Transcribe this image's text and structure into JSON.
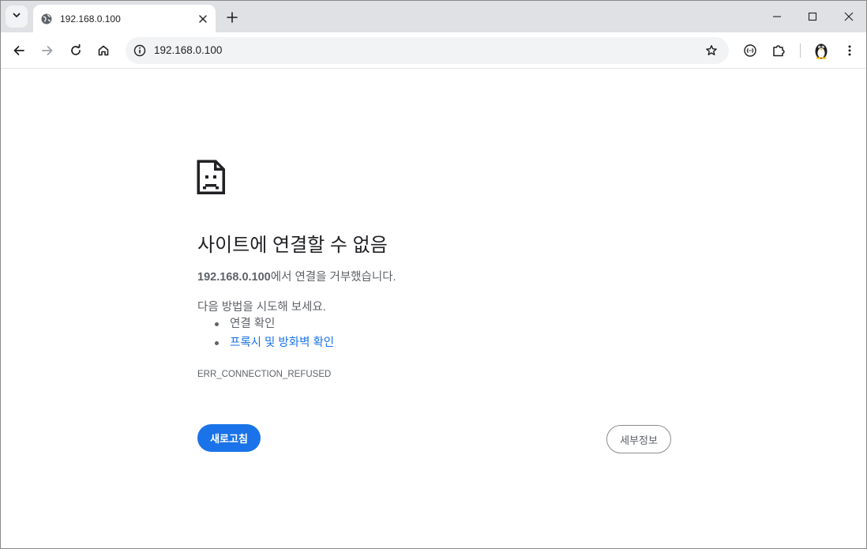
{
  "tab": {
    "title": "192.168.0.100"
  },
  "omnibox": {
    "url": "192.168.0.100"
  },
  "error": {
    "title": "사이트에 연결할 수 없음",
    "host": "192.168.0.100",
    "message_suffix": "에서 연결을 거부했습니다.",
    "suggestions_heading": "다음 방법을 시도해 보세요.",
    "suggestions": [
      {
        "label": "연결 확인"
      },
      {
        "label": "프록시 및 방화벽 확인"
      }
    ],
    "code": "ERR_CONNECTION_REFUSED",
    "reload_label": "새로고침",
    "details_label": "세부정보"
  },
  "colors": {
    "accent": "#1a73e8",
    "tabstrip": "#dfe1e5",
    "omnibox": "#f1f3f4",
    "text_secondary": "#5f6368"
  },
  "icons": [
    "chevron-down-icon",
    "globe-icon",
    "close-icon",
    "plus-icon",
    "minimize-icon",
    "maximize-icon",
    "window-close-icon",
    "back-arrow-icon",
    "forward-arrow-icon",
    "reload-icon",
    "home-icon",
    "info-icon",
    "star-icon",
    "reading-mode-icon",
    "extensions-icon",
    "profile-penguin-icon",
    "more-vert-icon",
    "sad-document-icon"
  ]
}
